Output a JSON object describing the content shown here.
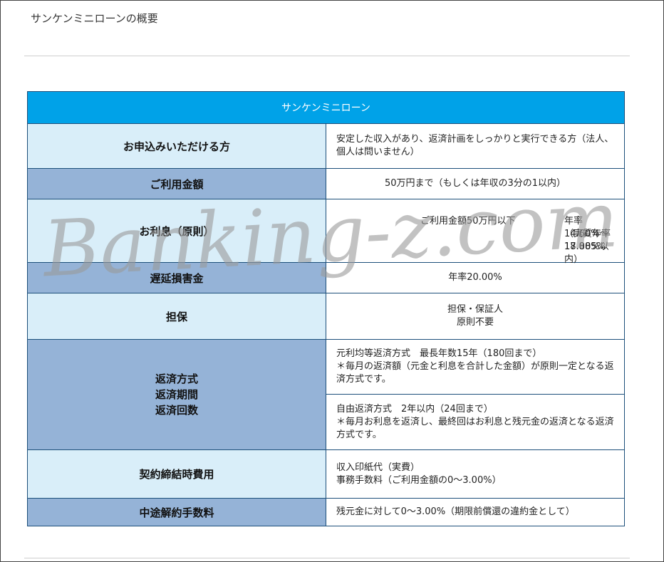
{
  "heading": "サンケンミニローンの概要",
  "table": {
    "title": "サンケンミニローン",
    "rows": {
      "eligible": {
        "label": "お申込みいただける方",
        "value": "安定した収入があり、返済計画をしっかりと実行できる方（法人、個人は問いません）"
      },
      "amount": {
        "label": "ご利用金額",
        "value": "50万円まで（もしくは年収の3分の1以内）"
      },
      "interest": {
        "label": "お利息（原則）",
        "condition": "ご利用金額50万円以下",
        "rate": "年率14.60%～17.885%",
        "actual": "（実質年率18.00%以内）"
      },
      "late": {
        "label": "遅延損害金",
        "value": "年率20.00%"
      },
      "collateral": {
        "label": "担保",
        "line1": "担保・保証人",
        "line2": "原則不要"
      },
      "repayment": {
        "label_line1": "返済方式",
        "label_line2": "返済期間",
        "label_line3": "返済回数",
        "method1_line1": "元利均等返済方式　最長年数15年（180回まで）",
        "method1_line2": "＊毎月の返済額（元金と利息を合計した金額）が原則一定となる返済方式です。",
        "method2_line1": "自由返済方式　2年以内（24回まで）",
        "method2_line2": "＊毎月お利息を返済し、最終回はお利息と残元金の返済となる返済方式です。"
      },
      "fees": {
        "label": "契約締結時費用",
        "line1": "収入印紙代（実費）",
        "line2": "事務手数料（ご利用金額の0～3.00%）"
      },
      "cancel": {
        "label": "中途解約手数料",
        "value": "残元金に対して0～3.00%（期限前償還の違約金として）"
      }
    }
  },
  "watermark": "Banking-z.com",
  "colors": {
    "title_bg": "#00a2e8",
    "label_light": "#d9eef9",
    "label_dark": "#95b3d7",
    "border": "#1c4f7a"
  }
}
